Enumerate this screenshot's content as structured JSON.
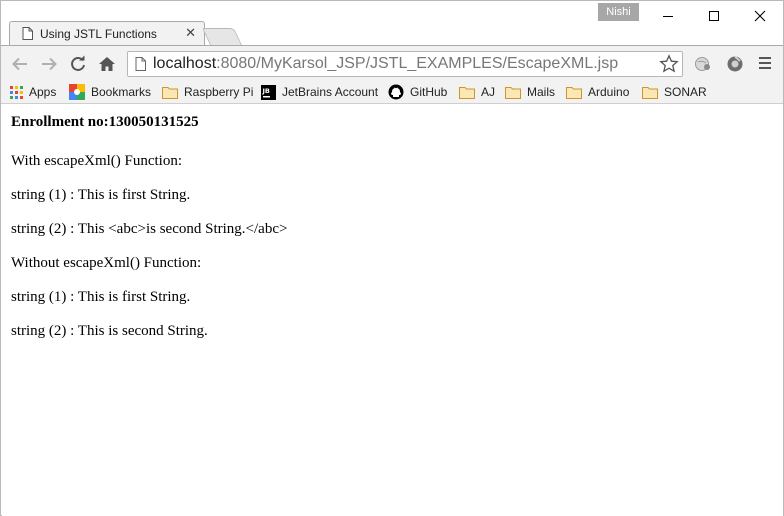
{
  "tab": {
    "title": "Using JSTL Functions",
    "close_glyph": "✕"
  },
  "profile": {
    "name": "Nishi"
  },
  "address_bar": {
    "host": "localhost",
    "path": ":8080/MyKarsol_JSP/JSTL_EXAMPLES/EscapeXML.jsp"
  },
  "bookmarks": [
    {
      "label": "Apps",
      "icon": "apps-grid-icon"
    },
    {
      "label": "Bookmarks",
      "icon": "bookmarks-icon"
    },
    {
      "label": "Raspberry Pi",
      "icon": "folder-icon"
    },
    {
      "label": "JetBrains Account",
      "icon": "jetbrains-icon"
    },
    {
      "label": "GitHub",
      "icon": "github-icon"
    },
    {
      "label": "AJ",
      "icon": "folder-icon"
    },
    {
      "label": "Mails",
      "icon": "folder-icon"
    },
    {
      "label": "Arduino",
      "icon": "folder-icon"
    },
    {
      "label": "SONAR",
      "icon": "folder-icon"
    }
  ],
  "page": {
    "enrollment": "Enrollment no:130050131525",
    "lines": [
      "With escapeXml() Function:",
      "string (1) : This is first String.",
      "string (2) : This <abc>is second String.</abc>",
      "Without escapeXml() Function:",
      "string (1) : This is first String.",
      "string (2) : This is second String."
    ]
  },
  "colors": {
    "chrome_bg": "#f2f2f2",
    "profile_bg": "#a7a7a7",
    "folder": "#e8b84a",
    "apps_grid": [
      "#e94235",
      "#fbbc04",
      "#34a853",
      "#4285f4"
    ]
  }
}
